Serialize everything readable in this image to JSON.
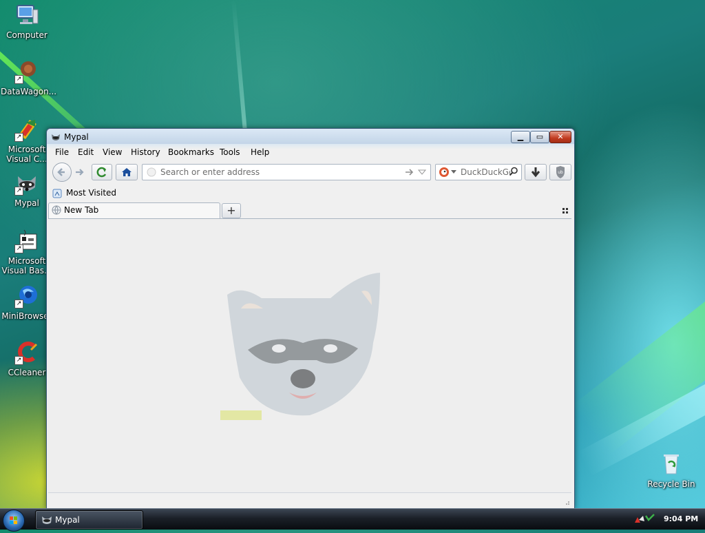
{
  "desktop": {
    "icons": [
      {
        "label": "Computer",
        "icon": "computer-icon"
      },
      {
        "label": "DataWagon...",
        "icon": "datawagon-icon"
      },
      {
        "label": "Microsoft Visual C...",
        "icon": "visual-c-icon"
      },
      {
        "label": "Mypal",
        "icon": "mypal-raccoon-icon"
      },
      {
        "label": "Microsoft Visual Bas...",
        "icon": "visual-basic-icon"
      },
      {
        "label": "MiniBrowser",
        "icon": "minibrowser-icon"
      },
      {
        "label": "CCleaner",
        "icon": "ccleaner-icon"
      },
      {
        "label": "Recycle Bin",
        "icon": "recycle-bin-icon"
      }
    ]
  },
  "window": {
    "title": "Mypal",
    "menus": [
      "File",
      "Edit",
      "View",
      "History",
      "Bookmarks",
      "Tools",
      "Help"
    ],
    "address": {
      "placeholder": "Search or enter address",
      "value": ""
    },
    "search": {
      "placeholder": "DuckDuckGo",
      "engine": "duckduckgo-icon"
    },
    "bookmarks": [
      {
        "label": "Most Visited"
      }
    ],
    "tabs": [
      {
        "label": "New Tab"
      }
    ],
    "colors": {
      "content_bg": "#eeeeee",
      "close_button": "#c23b20"
    }
  },
  "taskbar": {
    "active_window": "Mypal",
    "clock": "9:04 PM"
  }
}
